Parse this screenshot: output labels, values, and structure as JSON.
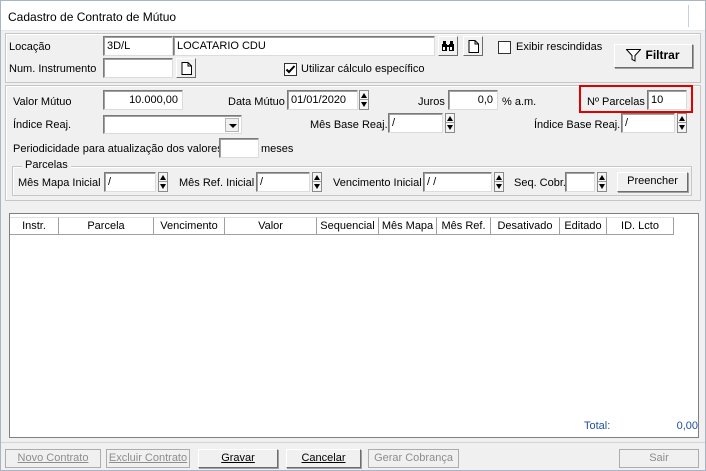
{
  "window": {
    "title": "Cadastro de Contrato de Mútuo"
  },
  "header": {
    "locacao_label": "Locação",
    "locacao_code": "3D/L",
    "locacao_name": "LOCATARIO CDU",
    "exibir_rescindidas_label": "Exibir rescindidas",
    "filtrar_label": "Filtrar",
    "num_instrumento_label": "Num. Instrumento",
    "num_instrumento_value": "",
    "utilizar_calculo_label": "Utilizar cálculo específico",
    "utilizar_calculo_checked": true
  },
  "form": {
    "valor_mutuo_label": "Valor Mútuo",
    "valor_mutuo_value": "10.000,00",
    "data_mutuo_label": "Data Mútuo",
    "data_mutuo_value": "01/01/2020",
    "juros_label": "Juros",
    "juros_value": "0,0",
    "juros_unit": "% a.m.",
    "n_parcelas_label": "Nº Parcelas",
    "n_parcelas_value": "10",
    "indice_reaj_label": "Índice Reaj.",
    "indice_reaj_value": "",
    "mes_base_reaj_label": "Mês Base Reaj.",
    "mes_base_reaj_value": "/",
    "indice_base_reaj_label": "Índice Base Reaj.",
    "indice_base_reaj_value": "/",
    "periodicidade_label": "Periodicidade para atualização dos valores",
    "periodicidade_value": "",
    "periodicidade_unit": "meses"
  },
  "parcelas": {
    "group_title": "Parcelas",
    "mes_mapa_inicial_label": "Mês Mapa Inicial",
    "mes_mapa_inicial_value": "/",
    "mes_ref_inicial_label": "Mês Ref. Inicial",
    "mes_ref_inicial_value": "/",
    "vencimento_inicial_label": "Vencimento Inicial",
    "vencimento_inicial_value": "/ /",
    "seq_cobr_label": "Seq. Cobr.",
    "seq_cobr_value": "",
    "preencher_label": "Preencher"
  },
  "grid": {
    "columns": [
      "Instr.",
      "Parcela",
      "Vencimento",
      "Valor",
      "Sequencial",
      "Mês Mapa",
      "Mês Ref.",
      "Desativado",
      "Editado",
      "ID. Lcto"
    ],
    "rows": []
  },
  "totals": {
    "label": "Total:",
    "value": "0,00"
  },
  "footer": {
    "novo_contrato": "Novo Contrato",
    "excluir_contrato": "Excluir Contrato",
    "gravar": "Gravar",
    "cancelar": "Cancelar",
    "gerar_cobranca": "Gerar Cobrança",
    "sair": "Sair"
  },
  "colors": {
    "highlight": "#e00000",
    "total_text": "#1f4fa0"
  }
}
